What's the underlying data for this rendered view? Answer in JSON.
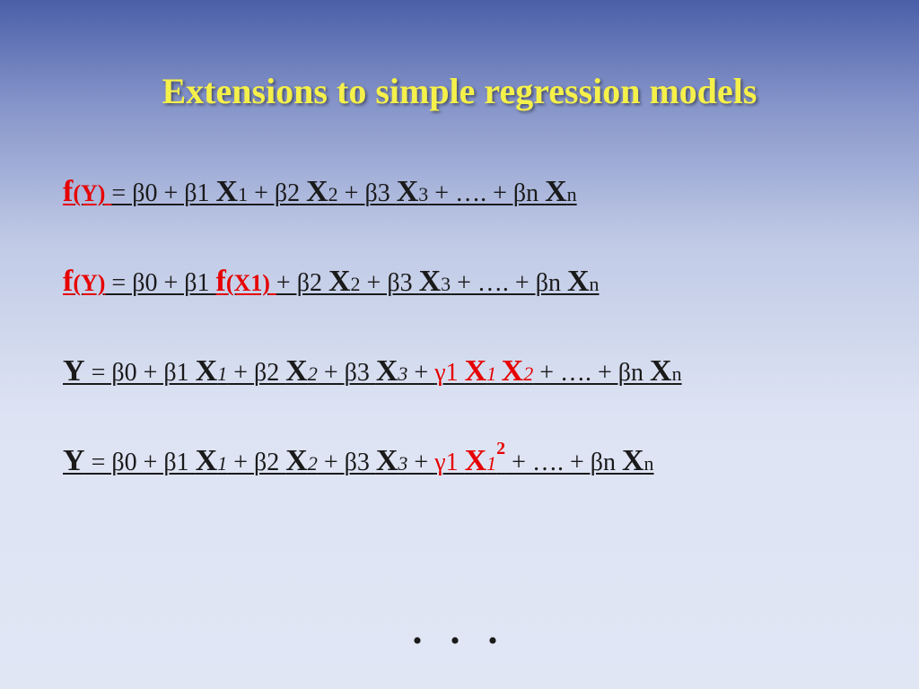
{
  "title": "Extensions to simple regression models",
  "eq1": {
    "fy": "f",
    "y": "(Y)",
    "rest": "=  β0   +   β1 ",
    "x1": "X",
    "x1s": "1",
    "mid1": "   +   β2 ",
    "x2": "X",
    "x2s": "2",
    "mid2": "   +   β3 ",
    "x3": "X",
    "x3s": "3",
    "tail1": "   +   ….   +   βn ",
    "xn": "X",
    "xns": "n"
  },
  "eq2": {
    "fy": "f",
    "y": "(Y)",
    "rest": " =  β0   +   β1 ",
    "f1": "f",
    "x1p": "(X1)",
    "mid1": "   +   β2 ",
    "x2": "X",
    "x2s": "2",
    "mid2": "   +   β3 ",
    "x3": "X",
    "x3s": "3",
    "tail1": "   +   ….   +   βn ",
    "xn": "X",
    "xns": "n"
  },
  "eq3": {
    "y": "Y",
    "rest": "  =  β0   +   β1 ",
    "x1": "X",
    "x1s": "1",
    "mid0": " + β2 ",
    "x2": "X",
    "x2s": "2",
    "mid1": "  + β3 ",
    "x3": "X",
    "x3s": "3",
    "plus": "  + ",
    "g": "γ1 ",
    "ix1": "X",
    "ix1s": "1 ",
    "ix2": "X",
    "ix2s": "2",
    "tail": " + …. + βn ",
    "xn": "X",
    "xns": "n"
  },
  "eq4": {
    "y": "Y",
    "rest": "  =  β0   +   β1 ",
    "x1": "X",
    "x1s": "1",
    "mid0": " + β2 ",
    "x2": "X",
    "x2s": "2",
    "mid1": "  + β3 ",
    "x3": "X",
    "x3s": "3",
    "plus": "  + ",
    "g": "γ1 ",
    "qx": "X",
    "qxs": "1",
    "sq": "2",
    "tail": " + …. + βn ",
    "xn": "X",
    "xns": "n"
  },
  "ellipsis": ". . ."
}
